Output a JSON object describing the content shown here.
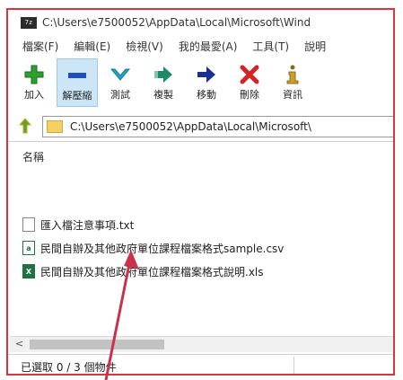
{
  "window": {
    "title": "C:\\Users\\e7500052\\AppData\\Local\\Microsoft\\Wind",
    "app_icon_text": "7z"
  },
  "menu": {
    "items": [
      "檔案(F)",
      "編輯(E)",
      "檢視(V)",
      "我的最愛(A)",
      "工具(T)",
      "說明"
    ]
  },
  "toolbar": {
    "buttons": [
      {
        "label": "加入",
        "icon": "add-icon",
        "color": "#2e9e2e"
      },
      {
        "label": "解壓縮",
        "icon": "extract-icon",
        "color": "#1f4fbf"
      },
      {
        "label": "測試",
        "icon": "test-icon",
        "color": "#1fa5c2"
      },
      {
        "label": "複製",
        "icon": "copy-icon",
        "color": "#1e8a6b"
      },
      {
        "label": "移動",
        "icon": "move-icon",
        "color": "#1b2f8f"
      },
      {
        "label": "刪除",
        "icon": "delete-icon",
        "color": "#d62222"
      },
      {
        "label": "資訊",
        "icon": "info-icon",
        "color": "#8a6a10"
      }
    ]
  },
  "address": {
    "path": "C:\\Users\\e7500052\\AppData\\Local\\Microsoft\\"
  },
  "list": {
    "column_name": "名稱",
    "files": [
      {
        "name": "匯入檔注意事項.txt",
        "type": "txt"
      },
      {
        "name": "民間自辦及其他政府單位課程檔案格式sample.csv",
        "type": "csv"
      },
      {
        "name": "民間自辦及其他政府單位課程檔案格式說明.xls",
        "type": "xls"
      }
    ]
  },
  "status": {
    "text": "已選取 0 / 3 個物件"
  },
  "colors": {
    "highlight_border": "#d9343f",
    "arrow": "#c8324a",
    "active_button_bg": "#cde6f7"
  }
}
